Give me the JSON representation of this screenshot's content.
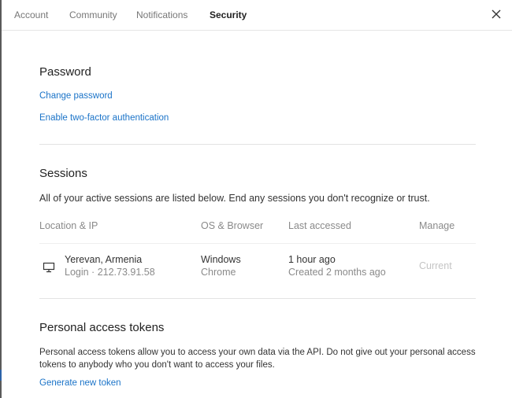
{
  "tabs": [
    {
      "label": "Account",
      "active": false
    },
    {
      "label": "Community",
      "active": false
    },
    {
      "label": "Notifications",
      "active": false
    },
    {
      "label": "Security",
      "active": true
    }
  ],
  "close_icon": "close-icon",
  "password": {
    "title": "Password",
    "change_link": "Change password",
    "two_factor_link": "Enable two-factor authentication"
  },
  "sessions": {
    "title": "Sessions",
    "description": "All of your active sessions are listed below. End any sessions you don't recognize or trust.",
    "columns": {
      "location": "Location & IP",
      "os": "OS & Browser",
      "accessed": "Last accessed",
      "manage": "Manage"
    },
    "rows": [
      {
        "icon": "monitor-icon",
        "location": "Yerevan, Armenia",
        "ip": "Login · 212.73.91.58",
        "os": "Windows",
        "browser": "Chrome",
        "last_accessed": "1 hour ago",
        "created": "Created 2 months ago",
        "manage": "Current"
      }
    ]
  },
  "tokens": {
    "title": "Personal access tokens",
    "description": "Personal access tokens allow you to access your own data via the API. Do not give out your personal access tokens to anybody who you don't want to access your files.",
    "generate_link": "Generate new token"
  },
  "colors": {
    "link": "#1a73c8",
    "muted": "#8a8a8a",
    "disabled": "#c4c4c4"
  }
}
